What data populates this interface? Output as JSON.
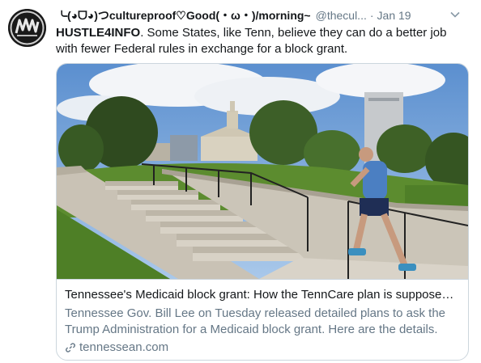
{
  "tweet": {
    "display_name": "╰(◕ᗜ◕)つcultureproof♡Good(・ω・)/morning~",
    "handle": "@thecul...",
    "separator": "·",
    "timestamp": "Jan 19",
    "mention": "HUSTLE4INFO",
    "text": ". Some States, like Tenn, believe they can do a better job with fewer Federal rules in exchange for a block grant."
  },
  "card": {
    "title": "Tennessee's Medicaid block grant: How the TennCare plan is supposed t...",
    "description": "Tennessee Gov. Bill Lee on Tuesday released detailed plans to ask the Trump Administration for a Medicaid block grant. Here are the details.",
    "domain": "tennessean.com"
  },
  "icons": {
    "caret": "chevron-down-icon",
    "link": "link-icon"
  }
}
